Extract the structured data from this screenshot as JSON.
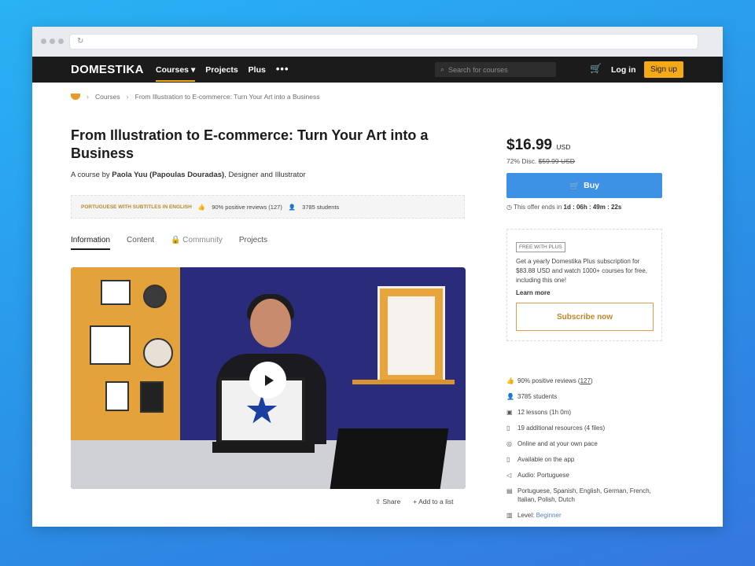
{
  "browser": {
    "url": ""
  },
  "navbar": {
    "logo": "DOMESTIKA",
    "links": [
      "Courses",
      "Projects",
      "Plus"
    ],
    "more": "•••",
    "search_placeholder": "Search for courses",
    "login": "Log in",
    "signup": "Sign up"
  },
  "breadcrumb": {
    "courses": "Courses",
    "current": "From Illustration to E-commerce: Turn Your Art into a Business"
  },
  "course": {
    "title": "From Illustration to E-commerce: Turn Your Art into a Business",
    "byline_prefix": "A course by",
    "author": "Paola Yuu (Papoulas Douradas)",
    "author_role": ", Designer and Illustrator",
    "language_badge": "PORTUGUESE WITH SUBTITLES IN ENGLISH",
    "reviews_short": "90% positive reviews (127)",
    "students_short": "3785 students"
  },
  "tabs": [
    "Information",
    "Content",
    "Community",
    "Projects"
  ],
  "actions": {
    "share": "Share",
    "add_to_list": "Add to a list"
  },
  "pricing": {
    "price": "$16.99",
    "currency": "USD",
    "discount_label": "72% Disc.",
    "original_price": "$59.99 USD",
    "buy": "Buy",
    "offer_prefix": "This offer ends in",
    "offer_time": "1d : 06h : 49m : 22s",
    "accent": "#3e92e6"
  },
  "plus": {
    "badge": "FREE WITH PLUS",
    "text": "Get a yearly Domestika Plus subscription for $83.88 USD and watch 1000+ courses for free, including this one!",
    "learn_more": "Learn more",
    "subscribe": "Subscribe now",
    "accent": "#f4a917"
  },
  "facts": {
    "reviews_prefix": "90% positive reviews (",
    "reviews_count": "127",
    "reviews_suffix": ")",
    "students": "3785 students",
    "lessons": "12 lessons (1h 0m)",
    "resources": "19 additional resources (4 files)",
    "online": "Online and at your own pace",
    "app": "Available on the app",
    "audio": "Audio: Portuguese",
    "subtitles": "Portuguese, Spanish, English, German, French, Italian, Polish, Dutch",
    "level_label": "Level:",
    "level_value": "Beginner"
  }
}
